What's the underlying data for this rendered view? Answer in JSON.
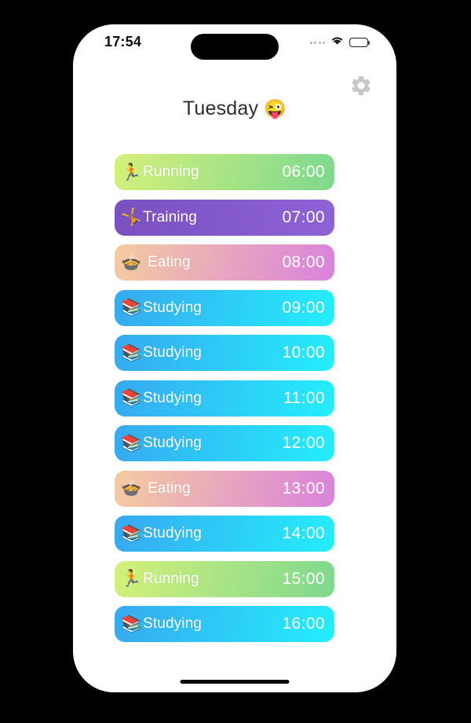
{
  "status_bar": {
    "time": "17:54",
    "signal_icon": "signal-dots-icon",
    "wifi_icon": "wifi-icon",
    "battery_icon": "battery-full-icon"
  },
  "header": {
    "settings_icon": "gear-icon",
    "title": "Tuesday",
    "title_emoji": "😜"
  },
  "schedule": {
    "rows": [
      {
        "activity": "Running",
        "emoji": "🏃",
        "time": "06:00",
        "type": "running"
      },
      {
        "activity": "Training",
        "emoji": "🤸",
        "time": "07:00",
        "type": "training"
      },
      {
        "activity": "Eating",
        "emoji": "🍲",
        "time": "08:00",
        "type": "eating"
      },
      {
        "activity": "Studying",
        "emoji": "📚",
        "time": "09:00",
        "type": "studying"
      },
      {
        "activity": "Studying",
        "emoji": "📚",
        "time": "10:00",
        "type": "studying"
      },
      {
        "activity": "Studying",
        "emoji": "📚",
        "time": "11:00",
        "type": "studying"
      },
      {
        "activity": "Studying",
        "emoji": "📚",
        "time": "12:00",
        "type": "studying"
      },
      {
        "activity": "Eating",
        "emoji": "🍲",
        "time": "13:00",
        "type": "eating"
      },
      {
        "activity": "Studying",
        "emoji": "📚",
        "time": "14:00",
        "type": "studying"
      },
      {
        "activity": "Running",
        "emoji": "🏃",
        "time": "15:00",
        "type": "running"
      },
      {
        "activity": "Studying",
        "emoji": "📚",
        "time": "16:00",
        "type": "studying"
      }
    ]
  },
  "colors": {
    "running_start": "#d4f07a",
    "running_end": "#7ed88f",
    "training_start": "#7a4fc0",
    "training_end": "#8f63d6",
    "eating_start": "#f5cba0",
    "eating_end": "#d982dc",
    "studying_start": "#37a9f0",
    "studying_end": "#24eefc",
    "gear": "#c8c8c8",
    "title_text": "#2d2d2d"
  },
  "home_indicator": "home-indicator"
}
